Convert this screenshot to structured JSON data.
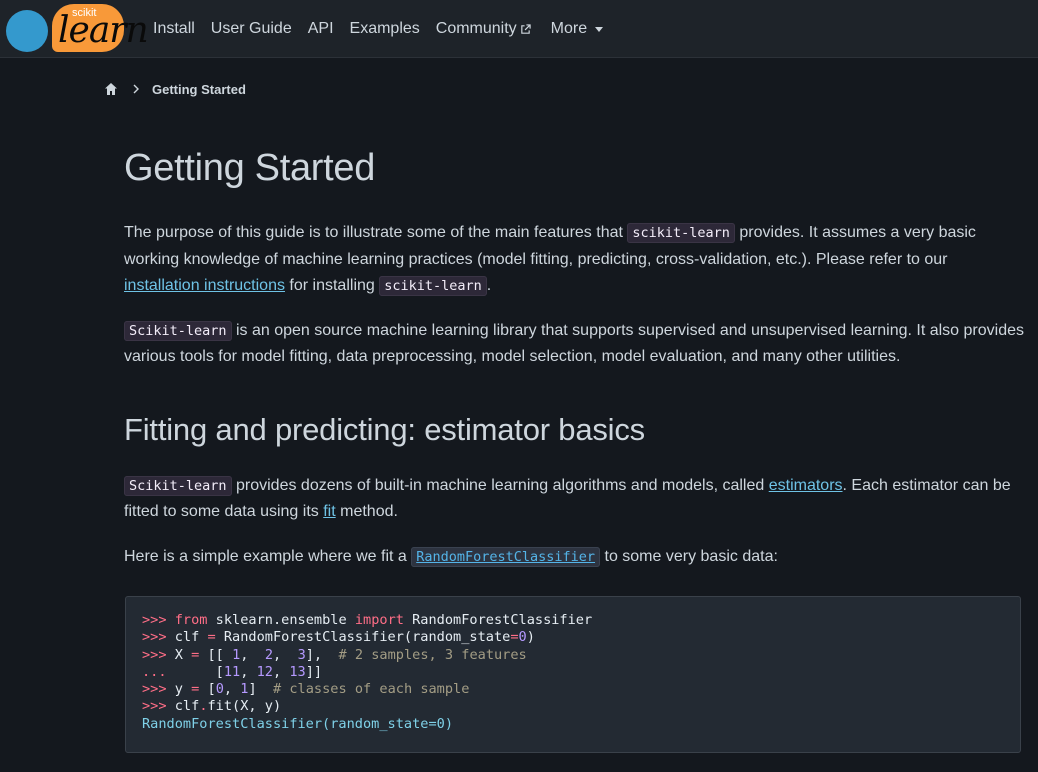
{
  "navbar": {
    "logo_small_text": "scikit",
    "logo_big_text": "learn",
    "links": [
      "Install",
      "User Guide",
      "API",
      "Examples"
    ],
    "community_label": "Community",
    "more_label": "More"
  },
  "breadcrumb": {
    "current": "Getting Started"
  },
  "page": {
    "title": "Getting Started",
    "intro": {
      "part1": "The purpose of this guide is to illustrate some of the main features that ",
      "code1": "scikit-learn",
      "part2": " provides. It assumes a very basic working knowledge of machine learning practices (model fitting, predicting, cross-validation, etc.). Please refer to our ",
      "link": "installation instructions",
      "part3": " for installing ",
      "code2": "scikit-learn",
      "part4": "."
    },
    "para2": {
      "code": "Scikit-learn",
      "text": " is an open source machine learning library that supports supervised and unsupervised learning. It also provides various tools for model fitting, data preprocessing, model selection, model evaluation, and many other utilities."
    },
    "section_title": "Fitting and predicting: estimator basics",
    "para3": {
      "code": "Scikit-learn",
      "part1": " provides dozens of built-in machine learning algorithms and models, called ",
      "link1": "estimators",
      "part2": ". Each estimator can be fitted to some data using its ",
      "link2": "fit",
      "part3": " method."
    },
    "para4": {
      "part1": "Here is a simple example where we fit a ",
      "code_link": "RandomForestClassifier",
      "part2": " to some very basic data:"
    }
  },
  "code": {
    "line1": {
      "prompt": ">>> ",
      "kw1": "from",
      "mod": " sklearn.ensemble ",
      "kw2": "import",
      "rest": " RandomForestClassifier"
    },
    "line2": {
      "prompt": ">>> ",
      "a": "clf ",
      "eq": "=",
      "b": " RandomForestClassifier(random_state",
      "eq2": "=",
      "n": "0",
      "c": ")"
    },
    "line3": {
      "prompt": ">>> ",
      "a": "X ",
      "eq": "=",
      "b": " [[ ",
      "n1": "1",
      "c1": ",  ",
      "n2": "2",
      "c2": ",  ",
      "n3": "3",
      "c3": "],  ",
      "cmt": "# 2 samples, 3 features"
    },
    "line4": {
      "prompt": "...",
      "a": "      [",
      "n1": "11",
      "c1": ", ",
      "n2": "12",
      "c2": ", ",
      "n3": "13",
      "c3": "]]"
    },
    "line5": {
      "prompt": ">>> ",
      "a": "y ",
      "eq": "=",
      "b": " [",
      "n1": "0",
      "c1": ", ",
      "n2": "1",
      "c2": "]  ",
      "cmt": "# classes of each sample"
    },
    "line6": {
      "prompt": ">>> ",
      "a": "clf",
      "dot": ".",
      "b": "fit(X, y)"
    },
    "output": "RandomForestClassifier(random_state=0)"
  }
}
